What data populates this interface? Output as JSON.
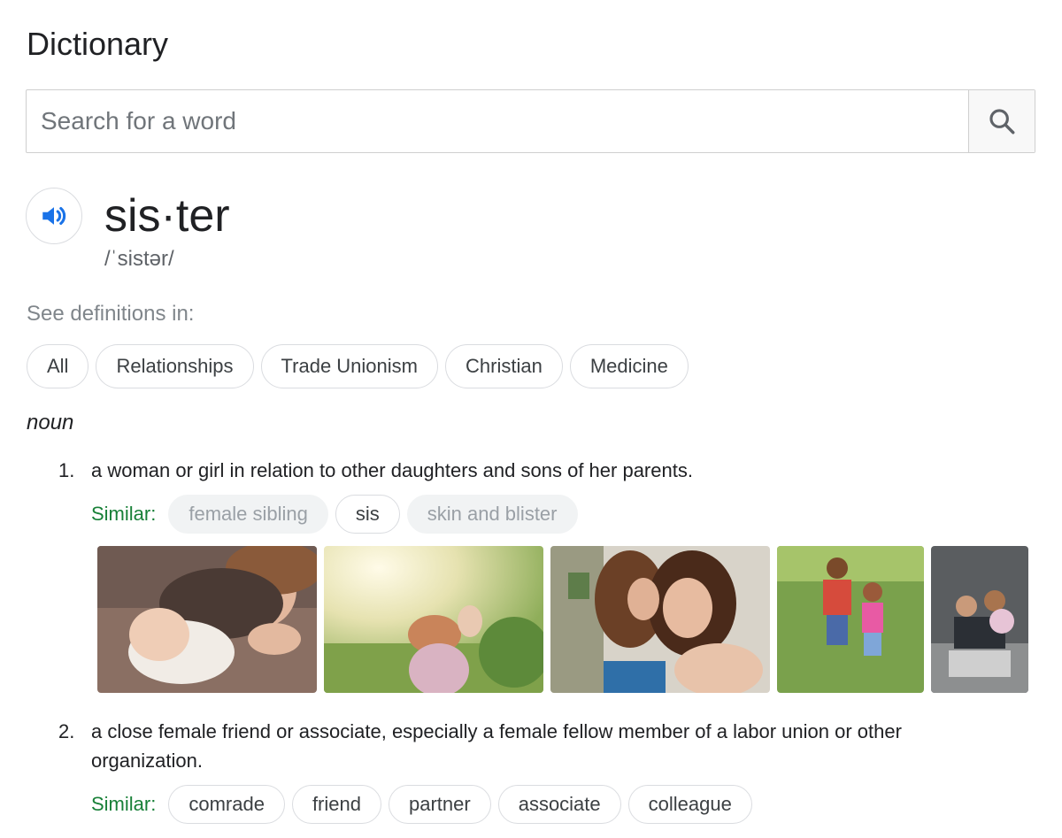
{
  "page": {
    "title": "Dictionary"
  },
  "search": {
    "placeholder": "Search for a word",
    "value": ""
  },
  "entry": {
    "word": "sis·ter",
    "phonetic": "/ˈsistər/",
    "see_definitions_label": "See definitions in:",
    "filter_chips": [
      "All",
      "Relationships",
      "Trade Unionism",
      "Christian",
      "Medicine"
    ],
    "part_of_speech": "noun",
    "senses": [
      {
        "number": "1.",
        "definition": "a woman or girl in relation to other daughters and sons of her parents.",
        "similar_label": "Similar:",
        "similar": [
          "female sibling",
          "sis",
          "skin and blister"
        ]
      },
      {
        "number": "2.",
        "definition": "a close female friend or associate, especially a female fellow member of a labor union or other organization.",
        "similar_label": "Similar:",
        "similar": [
          "comrade",
          "friend",
          "partner",
          "associate",
          "colleague"
        ]
      }
    ]
  },
  "colors": {
    "accent": "#1a73e8",
    "similar_label": "#188038",
    "muted_chip_bg": "#f1f3f4"
  },
  "icons": {
    "search": "search-icon",
    "speaker": "speaker-icon"
  }
}
